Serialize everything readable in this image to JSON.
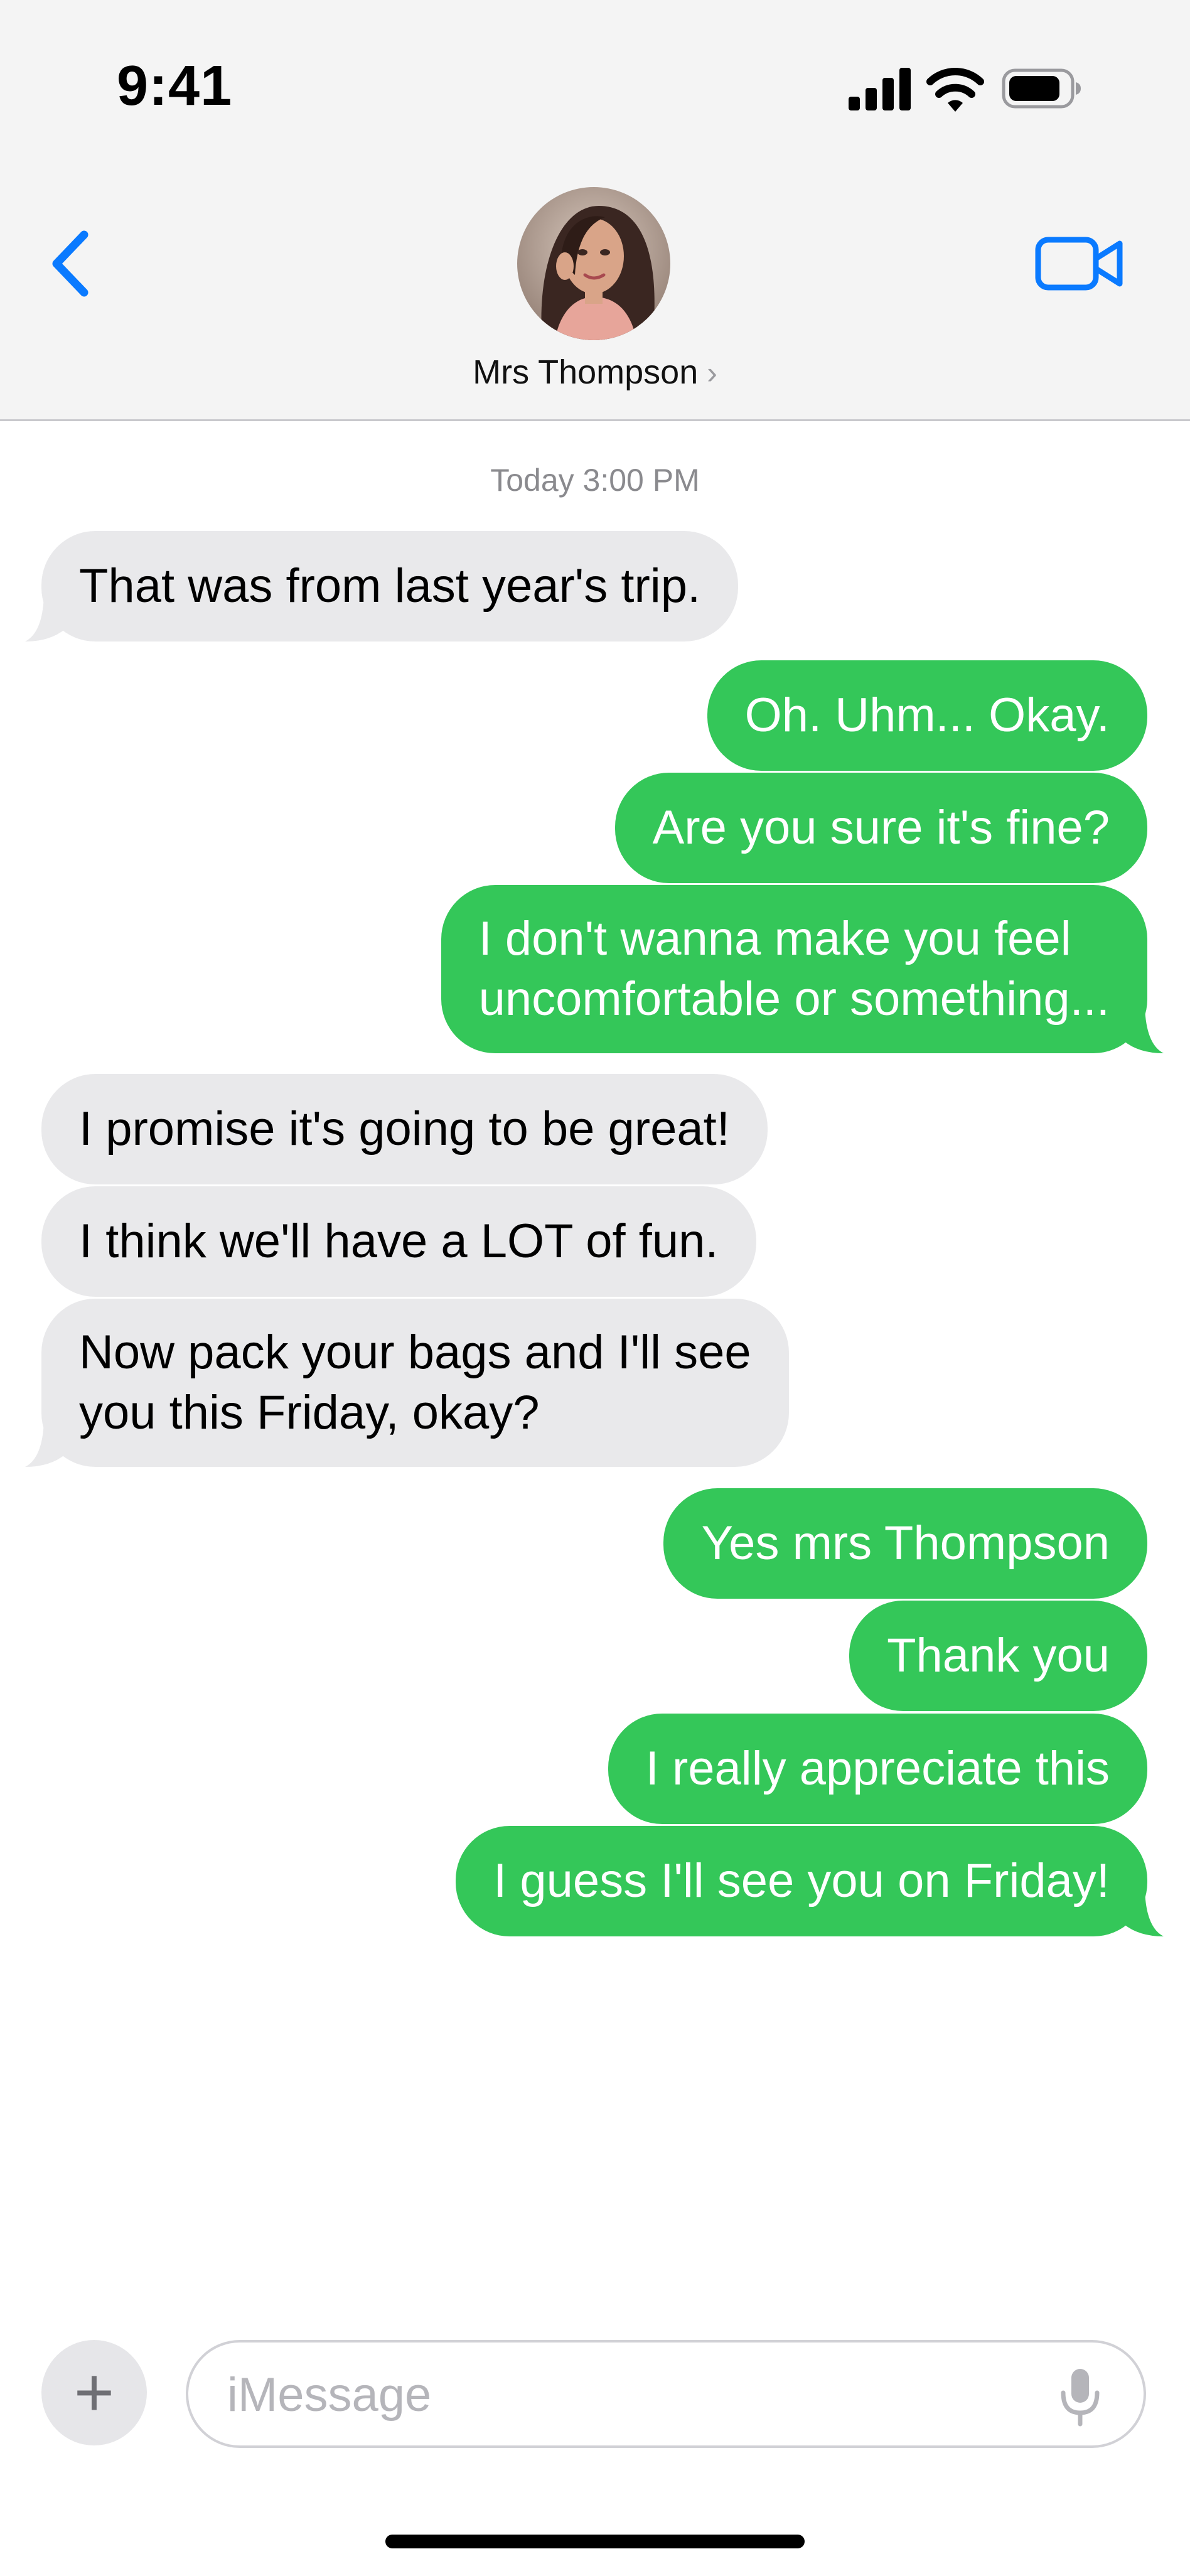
{
  "status_bar": {
    "time": "9:41"
  },
  "header": {
    "contact_name": "Mrs Thompson",
    "chevron": "›"
  },
  "conversation": {
    "timestamp": "Today 3:00 PM",
    "messages": [
      {
        "from": "contact",
        "lines": [
          "That was from last year's trip."
        ]
      },
      {
        "from": "me",
        "lines": [
          "Oh. Uhm... Okay."
        ]
      },
      {
        "from": "me",
        "lines": [
          "Are you sure it's fine?"
        ]
      },
      {
        "from": "me",
        "lines": [
          "I don't wanna make you feel",
          "uncomfortable or something..."
        ]
      },
      {
        "from": "contact",
        "lines": [
          "I promise it's going to be great!"
        ]
      },
      {
        "from": "contact",
        "lines": [
          "I think we'll have a LOT of fun."
        ]
      },
      {
        "from": "contact",
        "lines": [
          "Now pack your bags and I'll see",
          "you this Friday, okay?"
        ]
      },
      {
        "from": "me",
        "lines": [
          "Yes mrs Thompson"
        ]
      },
      {
        "from": "me",
        "lines": [
          "Thank you"
        ]
      },
      {
        "from": "me",
        "lines": [
          "I really appreciate this"
        ]
      },
      {
        "from": "me",
        "lines": [
          "I guess I'll see you on Friday!"
        ]
      }
    ]
  },
  "input_bar": {
    "plus_label": "+",
    "placeholder": "iMessage",
    "value": ""
  },
  "colors": {
    "sent_bubble": "#34c759",
    "received_bubble": "#e9e9eb",
    "accent": "#0a7aff",
    "header_bg": "#f4f4f4"
  },
  "icons": {
    "back": "chevron-left-icon",
    "video": "video-camera-icon",
    "mic": "microphone-icon",
    "signal": "cellular-signal-icon",
    "wifi": "wifi-icon",
    "battery": "battery-icon"
  }
}
